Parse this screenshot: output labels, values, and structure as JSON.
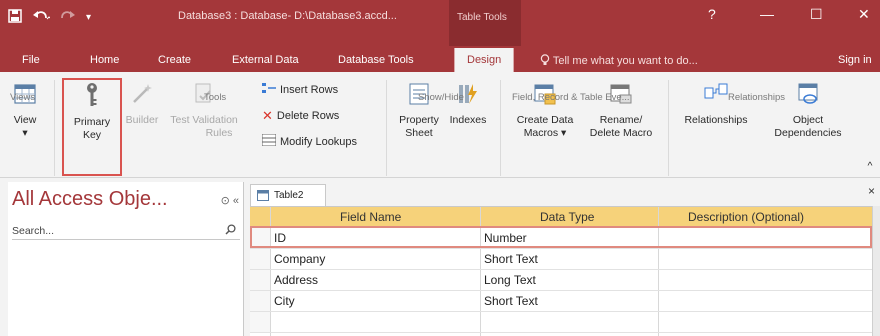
{
  "titlebar": {
    "qat": {
      "save_icon": "save-icon",
      "undo_icon": "undo-icon",
      "redo_icon": "redo-icon"
    },
    "title": "Database3 : Database- D:\\Database3.accd...",
    "context_group": "Table Tools",
    "help": "?",
    "minimize": "—",
    "restore": "☐",
    "close": "✕"
  },
  "tabs": {
    "file": "File",
    "home": "Home",
    "create": "Create",
    "external": "External Data",
    "dbtools": "Database Tools",
    "design": "Design",
    "tellme": "Tell me what you want to do...",
    "signin": "Sign in"
  },
  "ribbon": {
    "views": {
      "view_label": "View",
      "group": "Views"
    },
    "tools": {
      "primary_key_1": "Primary",
      "primary_key_2": "Key",
      "builder": "Builder",
      "test_validation_1": "Test Validation",
      "test_validation_2": "Rules",
      "insert_rows": "Insert Rows",
      "delete_rows": "Delete Rows",
      "modify_lookups": "Modify Lookups",
      "group": "Tools"
    },
    "showhide": {
      "property_1": "Property",
      "property_2": "Sheet",
      "indexes": "Indexes",
      "group": "Show/Hide"
    },
    "events": {
      "create_data_1": "Create Data",
      "create_data_2": "Macros ▾",
      "rename_1": "Rename/",
      "rename_2": "Delete Macro",
      "group": "Field, Record & Table Eve..."
    },
    "relationships": {
      "relationships": "Relationships",
      "object_dep_1": "Object",
      "object_dep_2": "Dependencies",
      "group": "Relationships"
    },
    "collapse": "^"
  },
  "nav": {
    "title": "All Access Obje...",
    "search_placeholder": "Search...",
    "dropdown_icon": "⊙",
    "collapse_icon": "«"
  },
  "doc": {
    "tab_label": "Table2",
    "close": "×",
    "columns": [
      "Field Name",
      "Data Type",
      "Description (Optional)"
    ],
    "rows": [
      {
        "field": "ID",
        "type": "Number"
      },
      {
        "field": "Company",
        "type": "Short Text"
      },
      {
        "field": "Address",
        "type": "Long Text"
      },
      {
        "field": "City",
        "type": "Short Text"
      }
    ]
  },
  "colors": {
    "accent": "#a4373a",
    "header": "#f6d27a",
    "highlight": "#d9534f"
  }
}
